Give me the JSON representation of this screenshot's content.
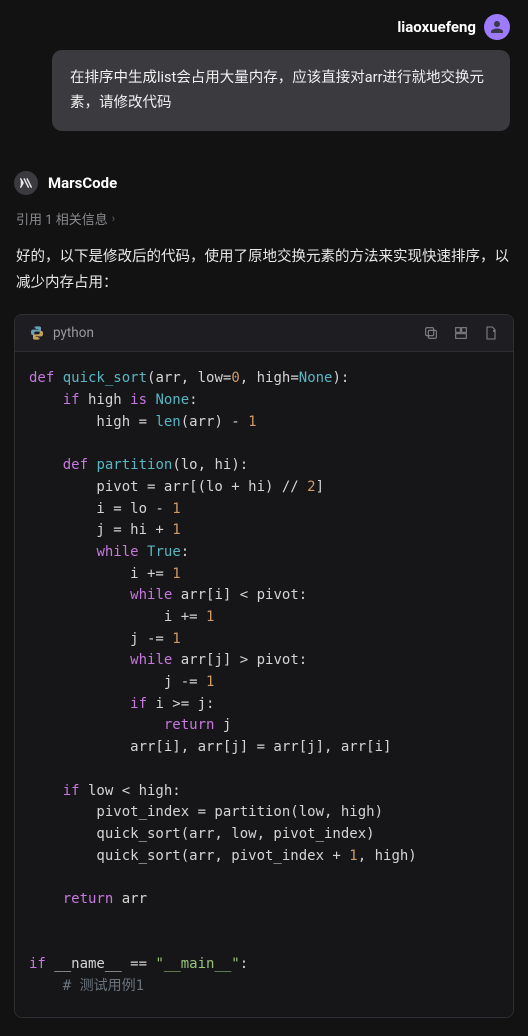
{
  "user": {
    "name": "liaoxuefeng"
  },
  "user_message": "在排序中生成list会占用大量内存，应该直接对arr进行就地交换元素，请修改代码",
  "assistant": {
    "name": "MarsCode"
  },
  "citation": {
    "text": "引用 1 相关信息"
  },
  "reply_text": "好的，以下是修改后的代码，使用了原地交换元素的方法来实现快速排序，以减少内存占用：",
  "code": {
    "language": "python",
    "lines": [
      {
        "t": "def ",
        "c": "kw"
      },
      {
        "t": "quick_sort",
        "c": "fn"
      },
      {
        "t": "(arr, low=",
        "c": "pm"
      },
      {
        "t": "0",
        "c": "nm"
      },
      {
        "t": ", high=",
        "c": "pm"
      },
      {
        "t": "None",
        "c": "bl"
      },
      {
        "t": "):",
        "c": "pm"
      },
      {
        "nl": 1
      },
      {
        "t": "    ",
        "c": ""
      },
      {
        "t": "if",
        "c": "kw"
      },
      {
        "t": " high ",
        "c": "id"
      },
      {
        "t": "is",
        "c": "kw"
      },
      {
        "t": " ",
        "c": ""
      },
      {
        "t": "None",
        "c": "bl"
      },
      {
        "t": ":",
        "c": "pm"
      },
      {
        "nl": 1
      },
      {
        "t": "        high = ",
        "c": "id"
      },
      {
        "t": "len",
        "c": "fn"
      },
      {
        "t": "(arr) - ",
        "c": "id"
      },
      {
        "t": "1",
        "c": "nm"
      },
      {
        "nl": 1
      },
      {
        "nl": 1
      },
      {
        "t": "    ",
        "c": ""
      },
      {
        "t": "def",
        "c": "kw"
      },
      {
        "t": " ",
        "c": ""
      },
      {
        "t": "partition",
        "c": "fn"
      },
      {
        "t": "(lo, hi):",
        "c": "pm"
      },
      {
        "nl": 1
      },
      {
        "t": "        pivot = arr[(lo + hi) // ",
        "c": "id"
      },
      {
        "t": "2",
        "c": "nm"
      },
      {
        "t": "]",
        "c": "id"
      },
      {
        "nl": 1
      },
      {
        "t": "        i = lo - ",
        "c": "id"
      },
      {
        "t": "1",
        "c": "nm"
      },
      {
        "nl": 1
      },
      {
        "t": "        j = hi + ",
        "c": "id"
      },
      {
        "t": "1",
        "c": "nm"
      },
      {
        "nl": 1
      },
      {
        "t": "        ",
        "c": ""
      },
      {
        "t": "while",
        "c": "kw"
      },
      {
        "t": " ",
        "c": ""
      },
      {
        "t": "True",
        "c": "bl"
      },
      {
        "t": ":",
        "c": "pm"
      },
      {
        "nl": 1
      },
      {
        "t": "            i += ",
        "c": "id"
      },
      {
        "t": "1",
        "c": "nm"
      },
      {
        "nl": 1
      },
      {
        "t": "            ",
        "c": ""
      },
      {
        "t": "while",
        "c": "kw"
      },
      {
        "t": " arr[i] < pivot:",
        "c": "id"
      },
      {
        "nl": 1
      },
      {
        "t": "                i += ",
        "c": "id"
      },
      {
        "t": "1",
        "c": "nm"
      },
      {
        "nl": 1
      },
      {
        "t": "            j -= ",
        "c": "id"
      },
      {
        "t": "1",
        "c": "nm"
      },
      {
        "nl": 1
      },
      {
        "t": "            ",
        "c": ""
      },
      {
        "t": "while",
        "c": "kw"
      },
      {
        "t": " arr[j] > pivot:",
        "c": "id"
      },
      {
        "nl": 1
      },
      {
        "t": "                j -= ",
        "c": "id"
      },
      {
        "t": "1",
        "c": "nm"
      },
      {
        "nl": 1
      },
      {
        "t": "            ",
        "c": ""
      },
      {
        "t": "if",
        "c": "kw"
      },
      {
        "t": " i >= j:",
        "c": "id"
      },
      {
        "nl": 1
      },
      {
        "t": "                ",
        "c": ""
      },
      {
        "t": "return",
        "c": "kw"
      },
      {
        "t": " j",
        "c": "id"
      },
      {
        "nl": 1
      },
      {
        "t": "            arr[i], arr[j] = arr[j], arr[i]",
        "c": "id"
      },
      {
        "nl": 1
      },
      {
        "nl": 1
      },
      {
        "t": "    ",
        "c": ""
      },
      {
        "t": "if",
        "c": "kw"
      },
      {
        "t": " low < high:",
        "c": "id"
      },
      {
        "nl": 1
      },
      {
        "t": "        pivot_index = partition(low, high)",
        "c": "id"
      },
      {
        "nl": 1
      },
      {
        "t": "        quick_sort(arr, low, pivot_index)",
        "c": "id"
      },
      {
        "nl": 1
      },
      {
        "t": "        quick_sort(arr, pivot_index + ",
        "c": "id"
      },
      {
        "t": "1",
        "c": "nm"
      },
      {
        "t": ", high)",
        "c": "id"
      },
      {
        "nl": 1
      },
      {
        "nl": 1
      },
      {
        "t": "    ",
        "c": ""
      },
      {
        "t": "return",
        "c": "kw"
      },
      {
        "t": " arr",
        "c": "id"
      },
      {
        "nl": 1
      },
      {
        "nl": 1
      },
      {
        "nl": 1
      },
      {
        "t": "if",
        "c": "kw"
      },
      {
        "t": " __name__ == ",
        "c": "id"
      },
      {
        "t": "\"__main__\"",
        "c": "st"
      },
      {
        "t": ":",
        "c": "pm"
      },
      {
        "nl": 1
      },
      {
        "t": "    ",
        "c": ""
      },
      {
        "t": "# 测试用例1",
        "c": "cm"
      }
    ]
  }
}
